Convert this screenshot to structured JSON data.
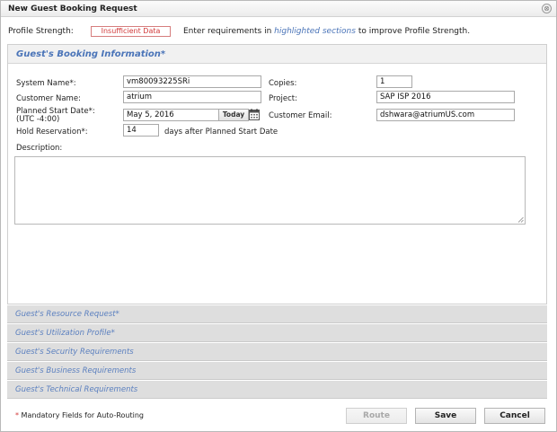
{
  "window": {
    "title": "New Guest Booking Request",
    "close_glyph": "⊗"
  },
  "strength": {
    "label": "Profile Strength:",
    "badge": "Insufficient Data",
    "hint_before": "Enter requirements in ",
    "hint_highlight": "highlighted sections",
    "hint_after": " to improve Profile Strength."
  },
  "booking": {
    "header": "Guest's Booking Information*",
    "system_name_label": "System Name*:",
    "system_name_value": "vm80093225SRi",
    "copies_label": "Copies:",
    "copies_value": "1",
    "customer_name_label": "Customer Name:",
    "customer_name_value": "atrium",
    "project_label": "Project:",
    "project_value": "SAP ISP 2016",
    "start_date_label": "Planned Start Date*:",
    "start_date_tz": "(UTC -4:00)",
    "start_date_value": "May 5, 2016",
    "today_label": "Today",
    "email_label": "Customer Email:",
    "email_value": "dshwara@atriumUS.com",
    "hold_label": "Hold Reservation*:",
    "hold_value": "14",
    "hold_suffix": "days after Planned Start Date",
    "description_label": "Description:",
    "description_value": ""
  },
  "sections": [
    {
      "label": "Guest's Resource Request*"
    },
    {
      "label": "Guest's Utilization Profile*"
    },
    {
      "label": "Guest's Security Requirements"
    },
    {
      "label": "Guest's Business Requirements"
    },
    {
      "label": "Guest's Technical Requirements"
    }
  ],
  "footer": {
    "asterisk": "*",
    "note": " Mandatory Fields for Auto-Routing",
    "route_label": "Route",
    "save_label": "Save",
    "cancel_label": "Cancel"
  },
  "icons": {
    "close": "close-circle-icon",
    "calendar": "calendar-icon",
    "resize": "resize-grip-icon"
  }
}
